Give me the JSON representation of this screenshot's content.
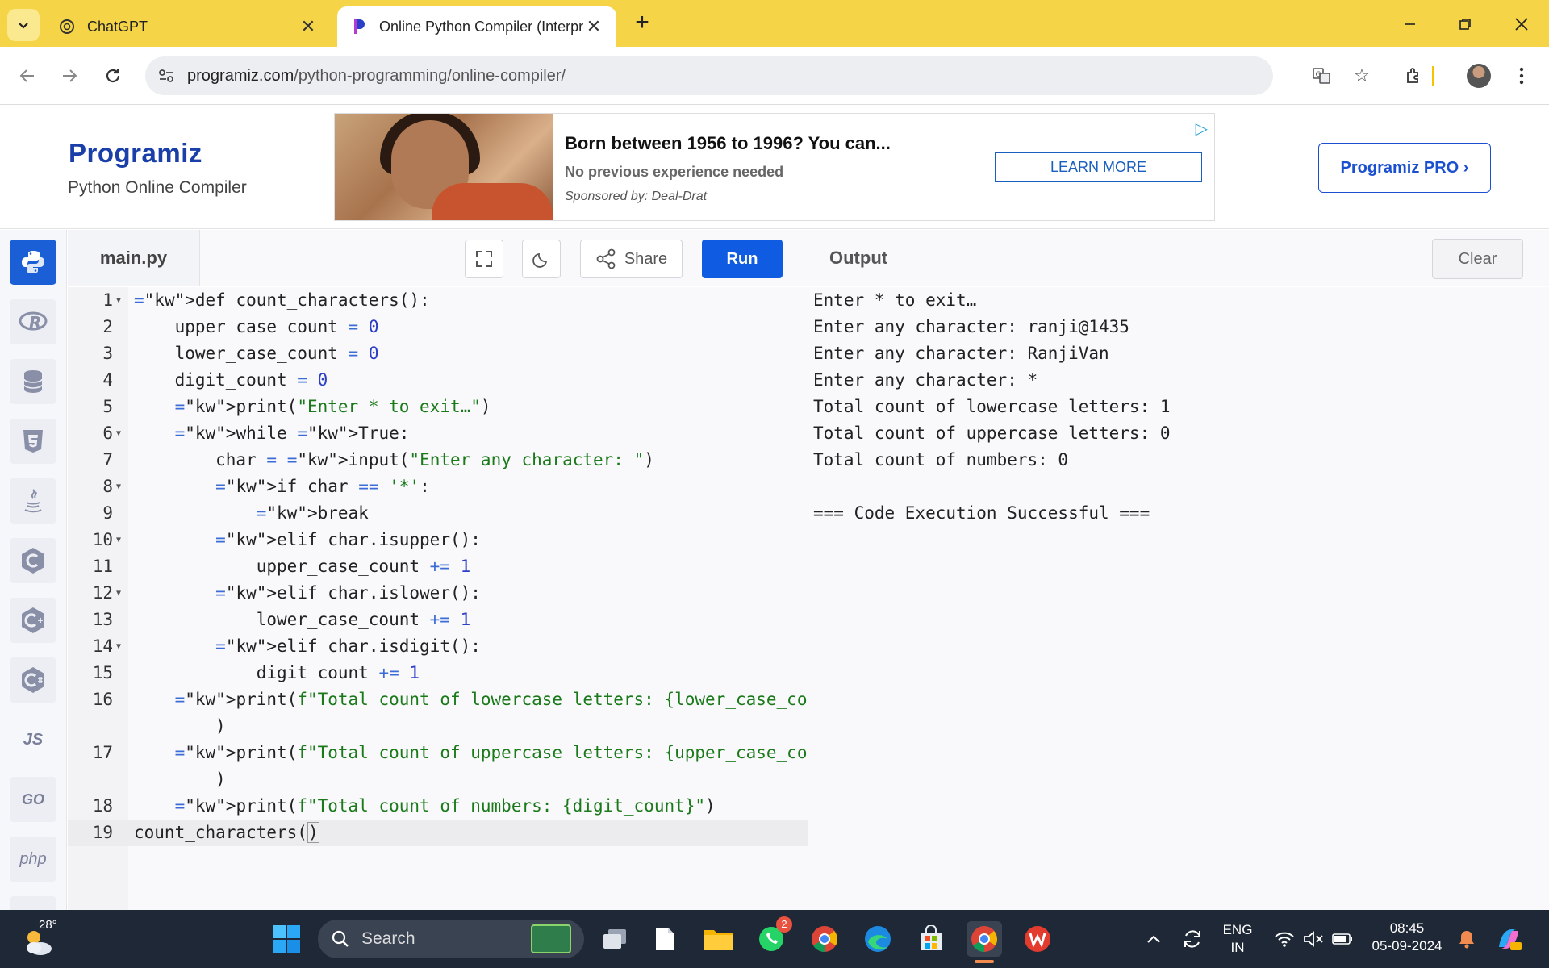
{
  "browser": {
    "tabs": [
      {
        "title": "ChatGPT",
        "active": false
      },
      {
        "title": "Online Python Compiler (Interpreter)",
        "active": true
      }
    ],
    "url_host": "programiz.com",
    "url_path": "/python-programming/online-compiler/"
  },
  "header": {
    "logo": "Programiz",
    "subtitle": "Python Online Compiler",
    "pro_button": "Programiz PRO ›"
  },
  "ad": {
    "headline": "Born between 1956 to 1996? You can...",
    "sub": "No previous experience needed",
    "sponsor": "Sponsored by: Deal-Drat",
    "cta": "LEARN MORE"
  },
  "sidebar": {
    "languages": [
      "python",
      "r",
      "sql",
      "html",
      "java",
      "c",
      "cpp",
      "csharp",
      "JS",
      "GO",
      "php"
    ]
  },
  "editor": {
    "file_name": "main.py",
    "share_label": "Share",
    "run_label": "Run",
    "lines": [
      "def count_characters():",
      "    upper_case_count = 0",
      "    lower_case_count = 0",
      "    digit_count = 0",
      "    print(\"Enter * to exit…\")",
      "    while True:",
      "        char = input(\"Enter any character: \")",
      "        if char == '*':",
      "            break",
      "        elif char.isupper():",
      "            upper_case_count += 1",
      "        elif char.islower():",
      "            lower_case_count += 1",
      "        elif char.isdigit():",
      "            digit_count += 1",
      "    print(f\"Total count of lowercase letters: {lower_case_count}\"",
      "    print(f\"Total count of uppercase letters: {upper_case_count}\"",
      "    print(f\"Total count of numbers: {digit_count}\")",
      "count_characters()"
    ]
  },
  "output": {
    "title": "Output",
    "clear_label": "Clear",
    "lines": [
      "Enter * to exit…",
      "Enter any character: ranji@1435",
      "Enter any character: RanjiVan",
      "Enter any character: *",
      "Total count of lowercase letters: 1",
      "Total count of uppercase letters: 0",
      "Total count of numbers: 0",
      "",
      "=== Code Execution Successful ==="
    ]
  },
  "taskbar": {
    "temperature": "28°",
    "search_placeholder": "Search",
    "whatsapp_badge": "2",
    "lang_line1": "ENG",
    "lang_line2": "IN",
    "time": "08:45",
    "date": "05-09-2024"
  },
  "colors": {
    "tab_strip": "#f5d547",
    "run_button": "#0f5ce3",
    "taskbar": "#1f2836"
  }
}
